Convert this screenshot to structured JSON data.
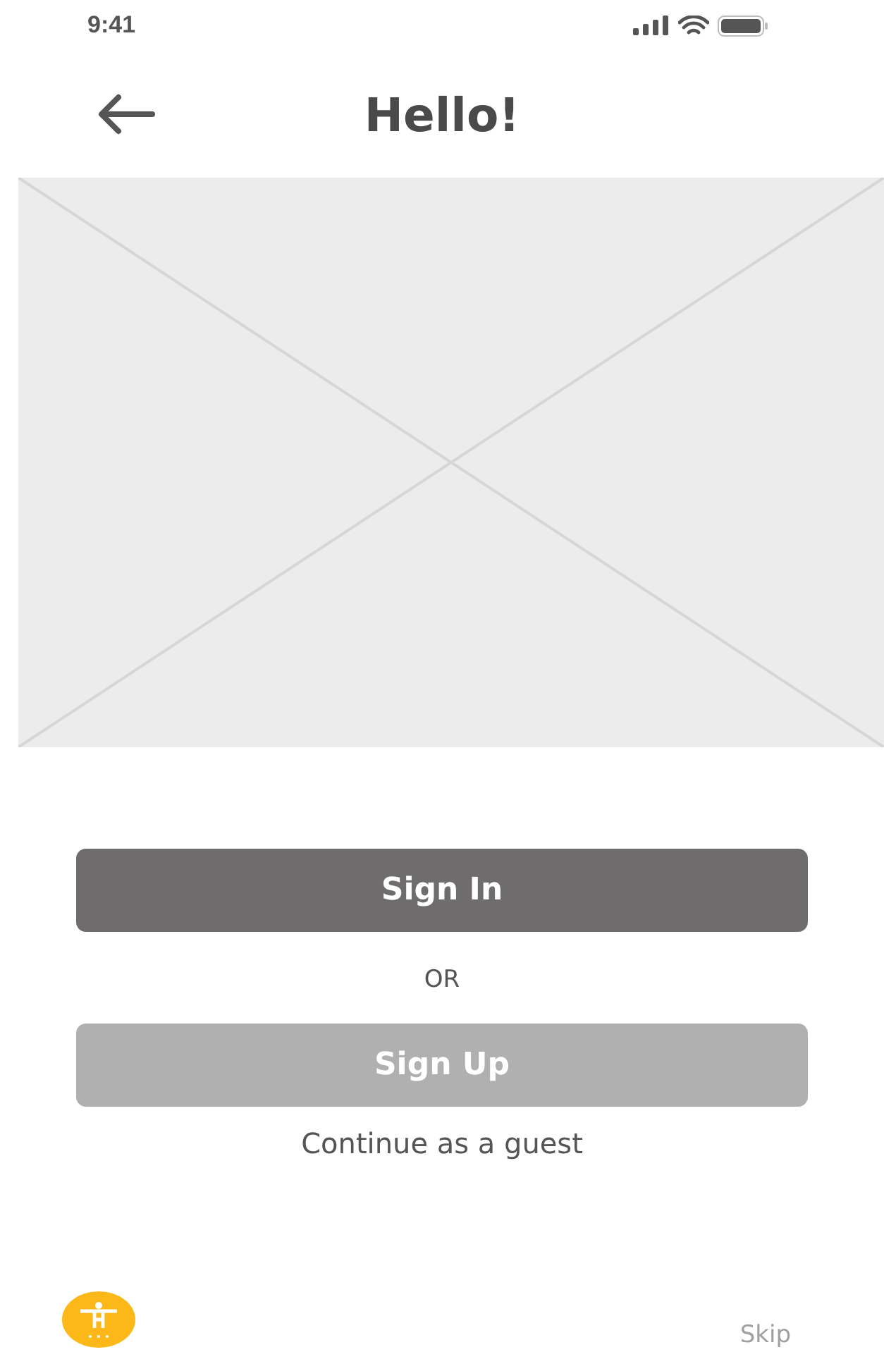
{
  "status_bar": {
    "time": "9:41"
  },
  "header": {
    "title": "Hello!"
  },
  "image": {
    "kind": "placeholder"
  },
  "buttons": [
    {
      "label": "Sign In",
      "disabled": false
    },
    {
      "label": "Sign Up",
      "disabled": true
    }
  ],
  "separator": "OR",
  "guest_link": "Continue as a guest",
  "footer": {
    "skip": "Skip"
  }
}
